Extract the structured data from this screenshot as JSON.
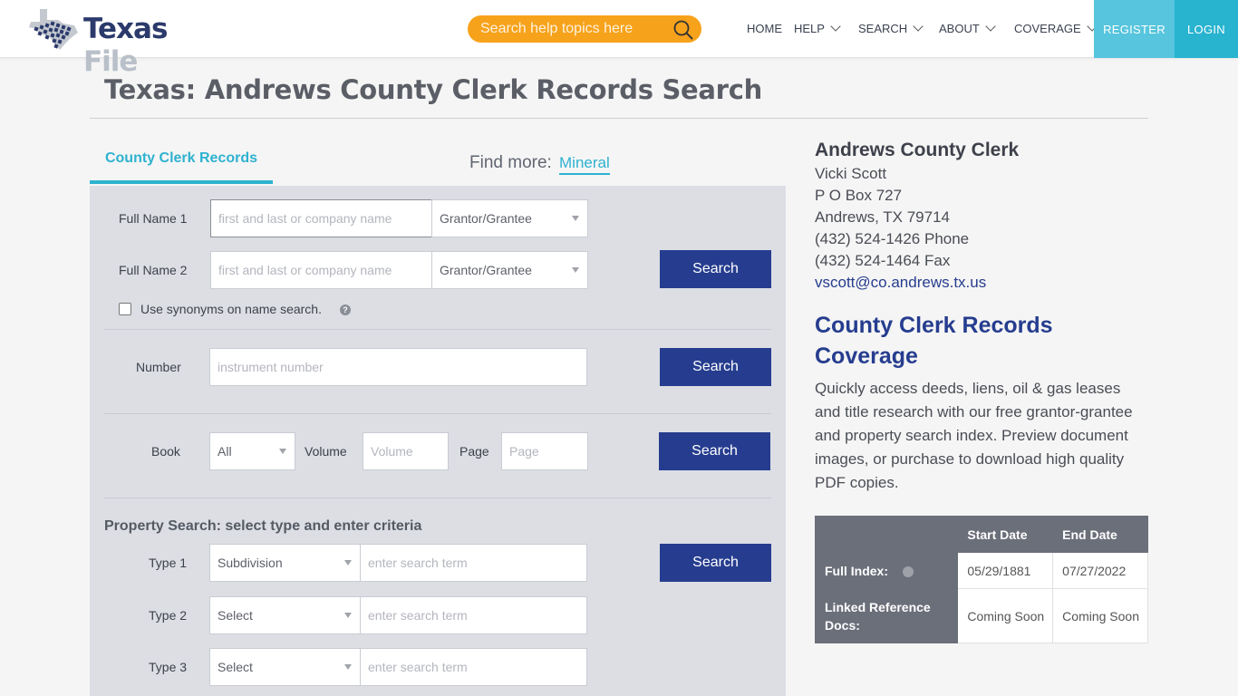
{
  "brand": {
    "name_part1": "Texas",
    "name_part2": "File"
  },
  "search": {
    "placeholder": "Search help topics here"
  },
  "nav": {
    "home": "HOME",
    "help": "HELP",
    "search": "SEARCH",
    "about": "ABOUT",
    "coverage": "COVERAGE",
    "register": "REGISTER",
    "login": "LOGIN"
  },
  "page": {
    "title": "Texas: Andrews County Clerk Records Search"
  },
  "tabs": {
    "active": "County Clerk Records",
    "find_more_label": "Find more:",
    "find_more_link": "Mineral"
  },
  "form": {
    "full_name_1_label": "Full Name 1",
    "full_name_2_label": "Full Name 2",
    "name_placeholder": "first and last or company name",
    "party_select_value": "Grantor/Grantee",
    "synonyms_label": "Use synonyms on name search.",
    "help_glyph": "?",
    "number_label": "Number",
    "number_placeholder": "instrument number",
    "book_label": "Book",
    "book_value": "All",
    "volume_label": "Volume",
    "volume_placeholder": "Volume",
    "page_label": "Page",
    "page_placeholder": "Page",
    "property_heading": "Property Search: select type and enter criteria",
    "type1_label": "Type 1",
    "type2_label": "Type 2",
    "type3_label": "Type 3",
    "type1_value": "Subdivision",
    "type_default_value": "Select",
    "term_placeholder": "enter search term",
    "search_button": "Search"
  },
  "clerk": {
    "title": "Andrews County Clerk",
    "name": "Vicki Scott",
    "address1": "P O Box 727",
    "address2": "Andrews, TX 79714",
    "phone": "(432) 524-1426 Phone",
    "fax": "(432) 524-1464 Fax",
    "email": "vscott@co.andrews.tx.us"
  },
  "coverage": {
    "title": "County Clerk Records Coverage",
    "text": "Quickly access deeds, liens, oil & gas leases and title research with our free grantor-grantee and property search index. Preview document images, or purchase to download high quality PDF copies.",
    "table": {
      "headers": [
        "",
        "Start Date",
        "End Date"
      ],
      "rows": [
        {
          "label": "Full Index:",
          "start": "05/29/1881",
          "end": "07/27/2022"
        },
        {
          "label": "Linked Reference Docs:",
          "start": "Coming Soon",
          "end": "Coming Soon"
        }
      ]
    }
  },
  "colors": {
    "brand_navy": "#263d8f",
    "accent_cyan": "#2eb2d0",
    "search_orange": "#f7a21b",
    "table_header_gray": "#6b6f7a"
  }
}
